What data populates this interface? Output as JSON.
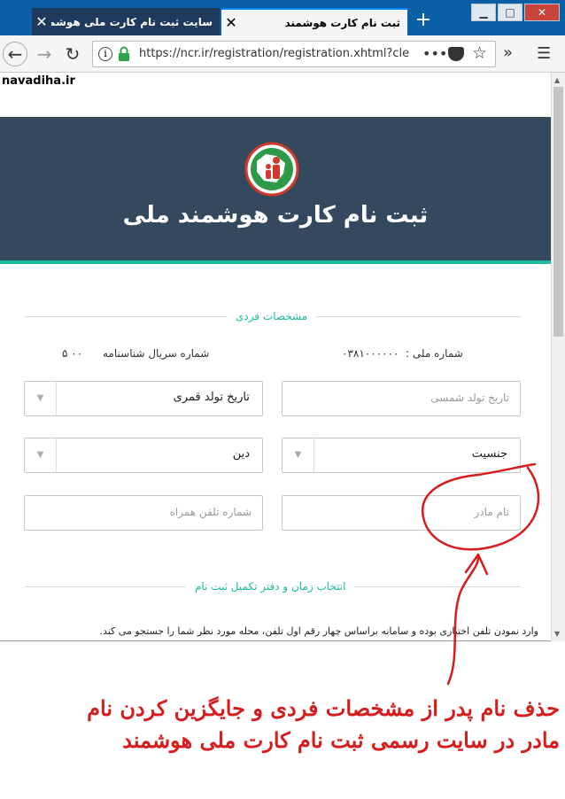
{
  "browser": {
    "tabs": [
      {
        "title": "سایت ثبت نام کارت ملی هوشمند ncr.ir",
        "active": false
      },
      {
        "title": "ثبت نام کارت هوشمند",
        "active": true
      }
    ],
    "url": "https://ncr.ir/registration/registration.xhtml?cle"
  },
  "watermark": "navadiha.ir",
  "page": {
    "title": "ثبت نام کارت هوشمند ملی",
    "section_personal": "مشخصات فردی",
    "national_id_label": "شماره ملی :",
    "national_id_value": "۰۳۸۱۰۰۰۰۰۰",
    "serial_label": "شماره سریال شناسنامه",
    "serial_value": "۵ ۰۰",
    "fields": {
      "birth_solar_placeholder": "تاریخ تولد شمسی",
      "birth_lunar_value": "تاریخ تولد قمری",
      "gender_value": "جنسیت",
      "religion_value": "دین",
      "mother_name_placeholder": "نام مادر",
      "mobile_placeholder": "شماره تلفن همراه"
    },
    "section_schedule": "انتخاب زمان و دفتر تکمیل ثبت نام",
    "note": "وارد نمودن تلفن اختیاری بوده و سامانه براساس چهار رقم اول تلفن، محله مورد نظر شما را جستجو می کند."
  },
  "annotation": {
    "caption_line1": "حذف نام پدر از مشخصات فردی و  جایگزین کردن نام",
    "caption_line2": "مادر در سایت رسمی ثبت نام کارت ملی هوشمند",
    "color": "#d61c1c"
  },
  "colors": {
    "header_bg": "#34495e",
    "accent": "#1abc9c"
  }
}
